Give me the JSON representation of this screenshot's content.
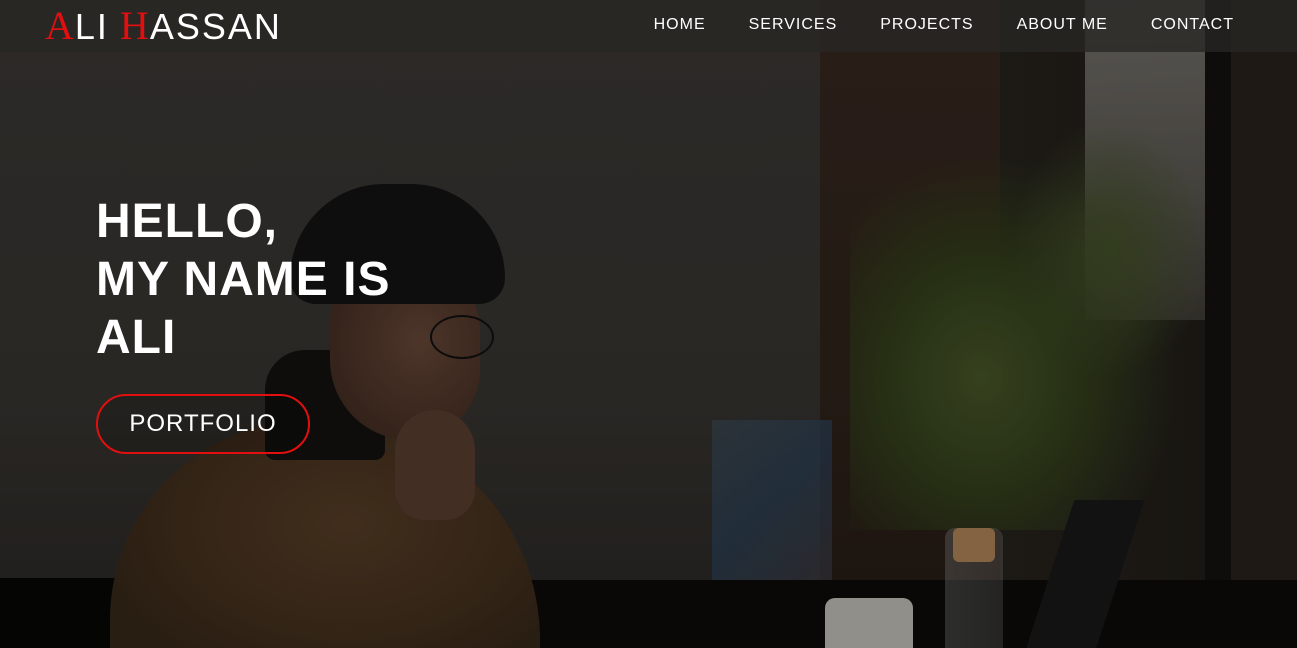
{
  "brand": {
    "first_initial": "A",
    "first_rest": "LI",
    "last_initial": "H",
    "last_rest": "ASSAN",
    "accent_color": "#e10f0f"
  },
  "nav": {
    "items": [
      {
        "label": "HOME"
      },
      {
        "label": "SERVICES"
      },
      {
        "label": "PROJECTS"
      },
      {
        "label": "ABOUT ME"
      },
      {
        "label": "CONTACT"
      }
    ]
  },
  "hero": {
    "lines": [
      "HELLO,",
      "MY NAME IS",
      "ALI"
    ],
    "button_label": "PORTFOLIO",
    "background_image": "photo-of-man-in-beanie-at-desk"
  }
}
